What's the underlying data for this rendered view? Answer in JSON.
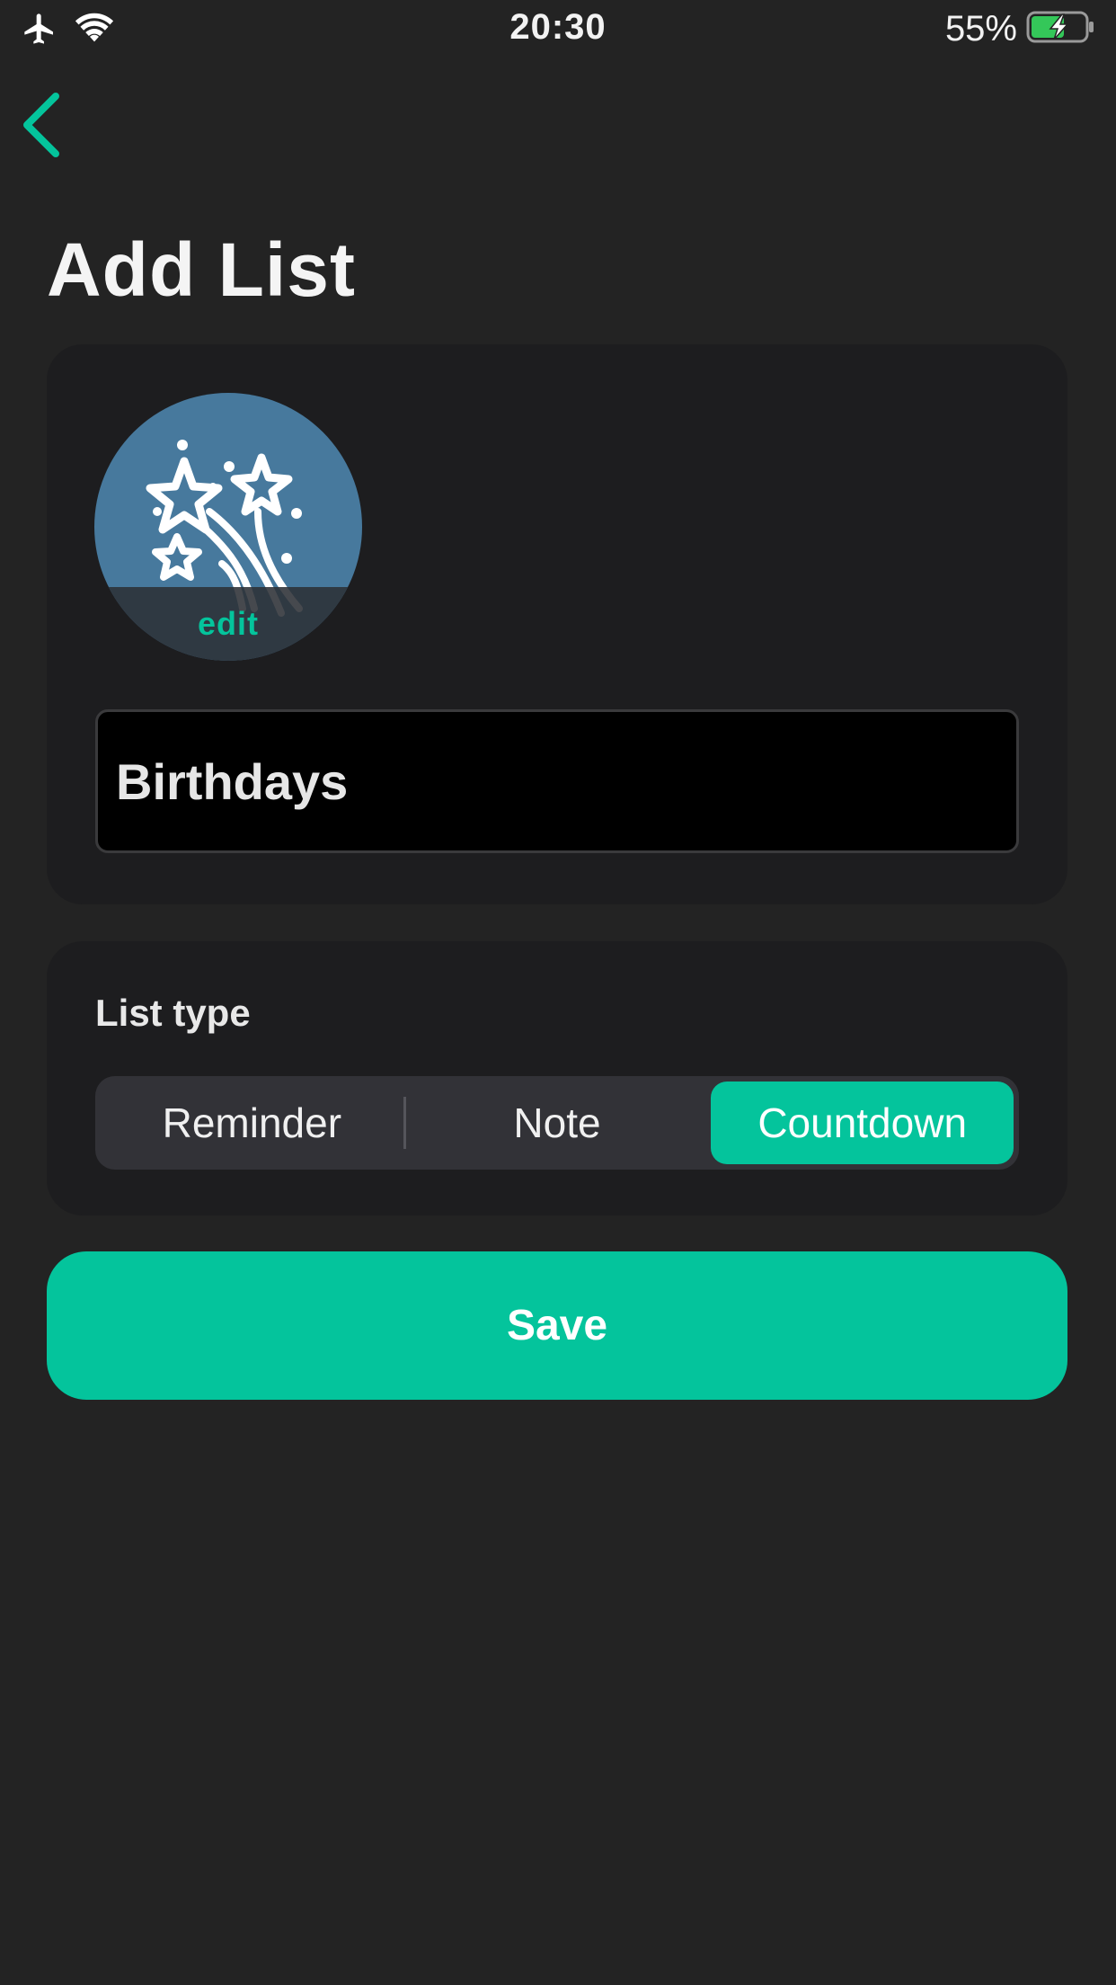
{
  "status_bar": {
    "time": "20:30",
    "battery_percent": "55%",
    "icons": [
      "airplane-icon",
      "wifi-icon",
      "battery-charging-icon"
    ]
  },
  "nav": {
    "back_icon": "chevron-left-icon"
  },
  "page": {
    "title": "Add List"
  },
  "list_editor": {
    "icon": "fireworks-icon",
    "icon_edit_label": "edit",
    "name_value": "Birthdays",
    "name_placeholder": ""
  },
  "list_type": {
    "label": "List type",
    "options": [
      "Reminder",
      "Note",
      "Countdown"
    ],
    "selected": "Countdown"
  },
  "actions": {
    "save_label": "Save"
  },
  "colors": {
    "accent": "#04c49c",
    "background": "#232323",
    "card": "#1d1d1f",
    "avatar": "#47799d",
    "battery_fill": "#34c759"
  }
}
